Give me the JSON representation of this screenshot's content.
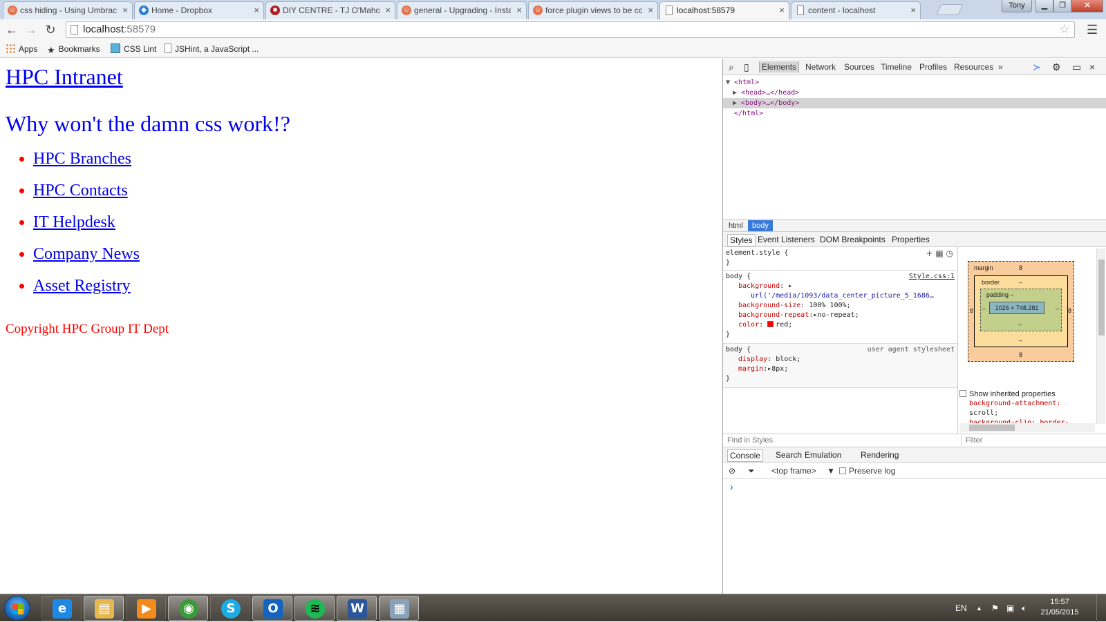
{
  "browser": {
    "tabs": [
      {
        "title": "css hiding - Using Umbraco",
        "icon": "umbraco-icon",
        "color": "#e5734f"
      },
      {
        "title": "Home - Dropbox",
        "icon": "dropbox-icon",
        "color": "#2a7fd4"
      },
      {
        "title": "DIY CENTRE - TJ O'Mahony",
        "icon": "tj-mahony-icon",
        "color": "#b01c23"
      },
      {
        "title": "general - Upgrading - Installing",
        "icon": "umbraco-icon",
        "color": "#e5734f"
      },
      {
        "title": "force plugin views to be compiled",
        "icon": "umbraco-icon",
        "color": "#e5734f"
      },
      {
        "title": "localhost:58579",
        "icon": "page-icon",
        "color": "#ffffff"
      },
      {
        "title": "content - localhost",
        "icon": "page-icon",
        "color": "#ffffff"
      }
    ],
    "tab_close_glyph": "×",
    "user_name": "Tony",
    "address": {
      "host": "localhost",
      "port": ":58579"
    },
    "bookmarks": [
      {
        "label": "Apps",
        "icon": "apps-icon"
      },
      {
        "label": "Bookmarks",
        "icon": "star-icon"
      },
      {
        "label": "CSS Lint",
        "icon": "css-lint-icon"
      },
      {
        "label": "JSHint, a JavaScript ...",
        "icon": "page-icon"
      }
    ]
  },
  "page": {
    "site_title": "HPC Intranet",
    "headline": "Why won't the damn css work!?",
    "nav_links": [
      "HPC Branches",
      "HPC Contacts",
      "IT Helpdesk",
      "Company News",
      "Asset Registry"
    ],
    "copyright": "Copyright HPC Group IT Dept"
  },
  "devtools": {
    "panels": [
      "Elements",
      "Network",
      "Sources",
      "Timeline",
      "Profiles",
      "Resources"
    ],
    "more_panels": "»",
    "dom_tree": [
      {
        "text": "<html>",
        "tri": "▼"
      },
      {
        "text": "<head>…</head>",
        "tri": "▶"
      },
      {
        "text": "<body>…</body>",
        "tri": "▶"
      },
      {
        "text": "</html>",
        "tri": ""
      }
    ],
    "breadcrumbs": [
      "html",
      "body"
    ],
    "sidebar_tabs": [
      "Styles",
      "Event Listeners",
      "DOM Breakpoints",
      "Properties"
    ],
    "styles": {
      "element_style": "element.style {",
      "close_brace": "}",
      "rule1_selector": "body {",
      "rule1_source": "Style.css:1",
      "rule1_props": [
        {
          "name": "background",
          "value": ""
        },
        {
          "name": "",
          "value": "url('/media/1093/data_center_picture_5_1686…"
        },
        {
          "name": "background-size",
          "value": "100% 100%;"
        },
        {
          "name": "background-repeat",
          "value": "no-repeat;"
        },
        {
          "name": "color",
          "value": "red;"
        }
      ],
      "rule2_selector": "body {",
      "rule2_source": "user agent stylesheet",
      "rule2_props": [
        {
          "name": "display",
          "value": "block;"
        },
        {
          "name": "margin",
          "value": "8px;"
        }
      ]
    },
    "box_model": {
      "margin_label": "margin",
      "margin": "8",
      "border_label": "border",
      "border": "–",
      "padding_label": "padding –",
      "content": "1026 × 748.281",
      "dash": "–"
    },
    "inherited": {
      "label": "Show inherited properties",
      "lines": [
        "background-attachment:",
        "scroll;",
        "background-clip: border-"
      ]
    },
    "find_in_styles_placeholder": "Find in Styles",
    "filter_placeholder": "Filter",
    "console_tabs": [
      "Console",
      "Search",
      "Emulation",
      "Rendering"
    ],
    "console_frame": "<top frame>",
    "preserve_log": "Preserve log",
    "prompt": "›"
  },
  "taskbar": {
    "apps": [
      {
        "name": "internet-explorer",
        "glyph": "e",
        "color": "#1e88e5"
      },
      {
        "name": "file-explorer",
        "glyph": "▤",
        "color": "#e7b84f"
      },
      {
        "name": "media-player",
        "glyph": "▶",
        "color": "#f28b1b"
      },
      {
        "name": "chrome",
        "glyph": "◉",
        "color": "#3b9b3b"
      },
      {
        "name": "skype",
        "glyph": "S",
        "color": "#1dabe5"
      },
      {
        "name": "outlook",
        "glyph": "O",
        "color": "#1565c0"
      },
      {
        "name": "spotify",
        "glyph": "≋",
        "color": "#1db954"
      },
      {
        "name": "word",
        "glyph": "W",
        "color": "#2b579a"
      },
      {
        "name": "virtual-machine",
        "glyph": "▦",
        "color": "#8aa2b8"
      }
    ],
    "language": "EN",
    "time": "15:57",
    "date": "21/05/2015"
  }
}
